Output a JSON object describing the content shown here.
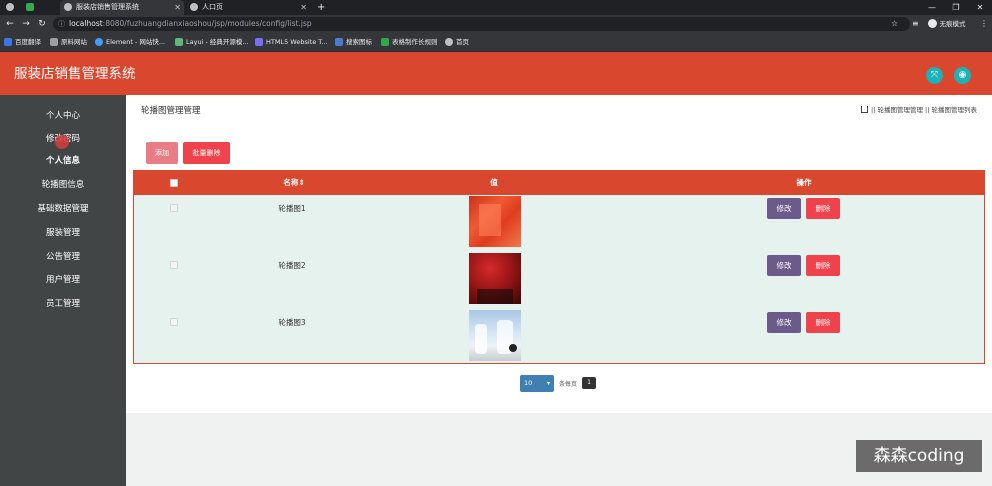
{
  "browser": {
    "tabs": [
      {
        "label": "",
        "active": false
      },
      {
        "label": "",
        "active": false
      },
      {
        "label": "服装店销售管理系统",
        "active": true
      },
      {
        "label": "人口页",
        "active": false
      }
    ],
    "new_tab": "+",
    "url_host": "localhost",
    "url_rest": ":8080/fuzhuangdianxiaoshou/jsp/modules/config/list.jsp",
    "profile_label": "无痕模式",
    "bookmarks": [
      "百度翻译",
      "原料网站",
      "Element - 网站快...",
      "Layui - 经典开源模...",
      "HTML5 Website T...",
      "搜索图标",
      "表格制作长规则",
      "首页"
    ]
  },
  "app": {
    "title": "服装店销售管理系统",
    "header_icons": [
      "expand-icon",
      "user-icon"
    ],
    "colors": {
      "primary": "#d9472f",
      "teal": "#1bb2b8",
      "sidebar": "#414545",
      "edit": "#6c5a8a",
      "delete": "#f0424c"
    }
  },
  "sidebar": {
    "items": [
      {
        "label": "个人中心"
      },
      {
        "label": "修改密码"
      },
      {
        "label": "个人信息"
      },
      {
        "label": "轮播图信息"
      },
      {
        "label": "基础数据管理"
      },
      {
        "label": "服装管理"
      },
      {
        "label": "公告管理"
      },
      {
        "label": "用户管理"
      },
      {
        "label": "员工管理"
      }
    ]
  },
  "main": {
    "page_title": "轮播图管理管理",
    "breadcrumb": "|| 轮播图管理管理 || 轮播图管理列表",
    "add_button": "添加",
    "batch_delete_button": "批量删除",
    "table": {
      "headers": {
        "name": "名称⇕",
        "value": "值",
        "actions": "操作"
      },
      "rows": [
        {
          "name": "轮播图1",
          "edit": "修改",
          "delete": "删除"
        },
        {
          "name": "轮播图2",
          "edit": "修改",
          "delete": "删除"
        },
        {
          "name": "轮播图3",
          "edit": "修改",
          "delete": "删除"
        }
      ]
    },
    "pager": {
      "page_size": "10",
      "per_page_label": "条每页",
      "current_page": "1"
    }
  },
  "watermark": "森森coding"
}
